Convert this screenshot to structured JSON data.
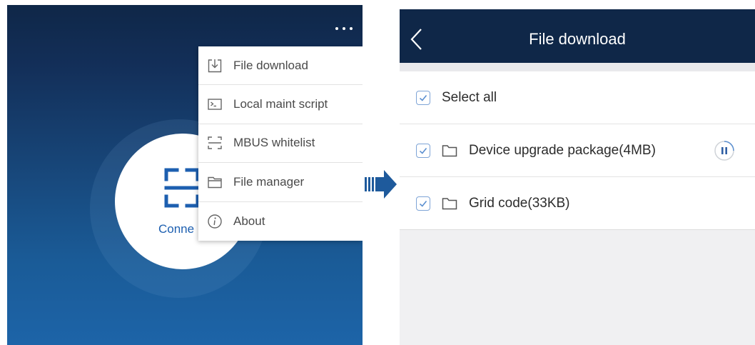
{
  "left_screen": {
    "more_icon": "more-dots-icon",
    "connect_label": "Conne",
    "menu": {
      "items": [
        {
          "label": "File download",
          "icon": "download-icon"
        },
        {
          "label": "Local maint script",
          "icon": "terminal-icon"
        },
        {
          "label": "MBUS whitelist",
          "icon": "scan-frame-icon"
        },
        {
          "label": "File manager",
          "icon": "folder-icon"
        },
        {
          "label": "About",
          "icon": "info-icon"
        }
      ]
    }
  },
  "right_screen": {
    "title": "File download",
    "back_icon": "back-chevron-icon",
    "select_all": {
      "label": "Select all",
      "checked": true
    },
    "files": [
      {
        "name": "Device upgrade package(4MB)",
        "checked": true,
        "icon": "folder-icon",
        "action_icon": "pause-icon"
      },
      {
        "name": "Grid code(33KB)",
        "checked": true,
        "icon": "folder-icon"
      }
    ]
  },
  "colors": {
    "header_navy": "#0f2748",
    "gradient_bottom": "#1d64a8",
    "accent_blue": "#1d5fb0",
    "checkbox_blue": "#7ea4d6"
  }
}
